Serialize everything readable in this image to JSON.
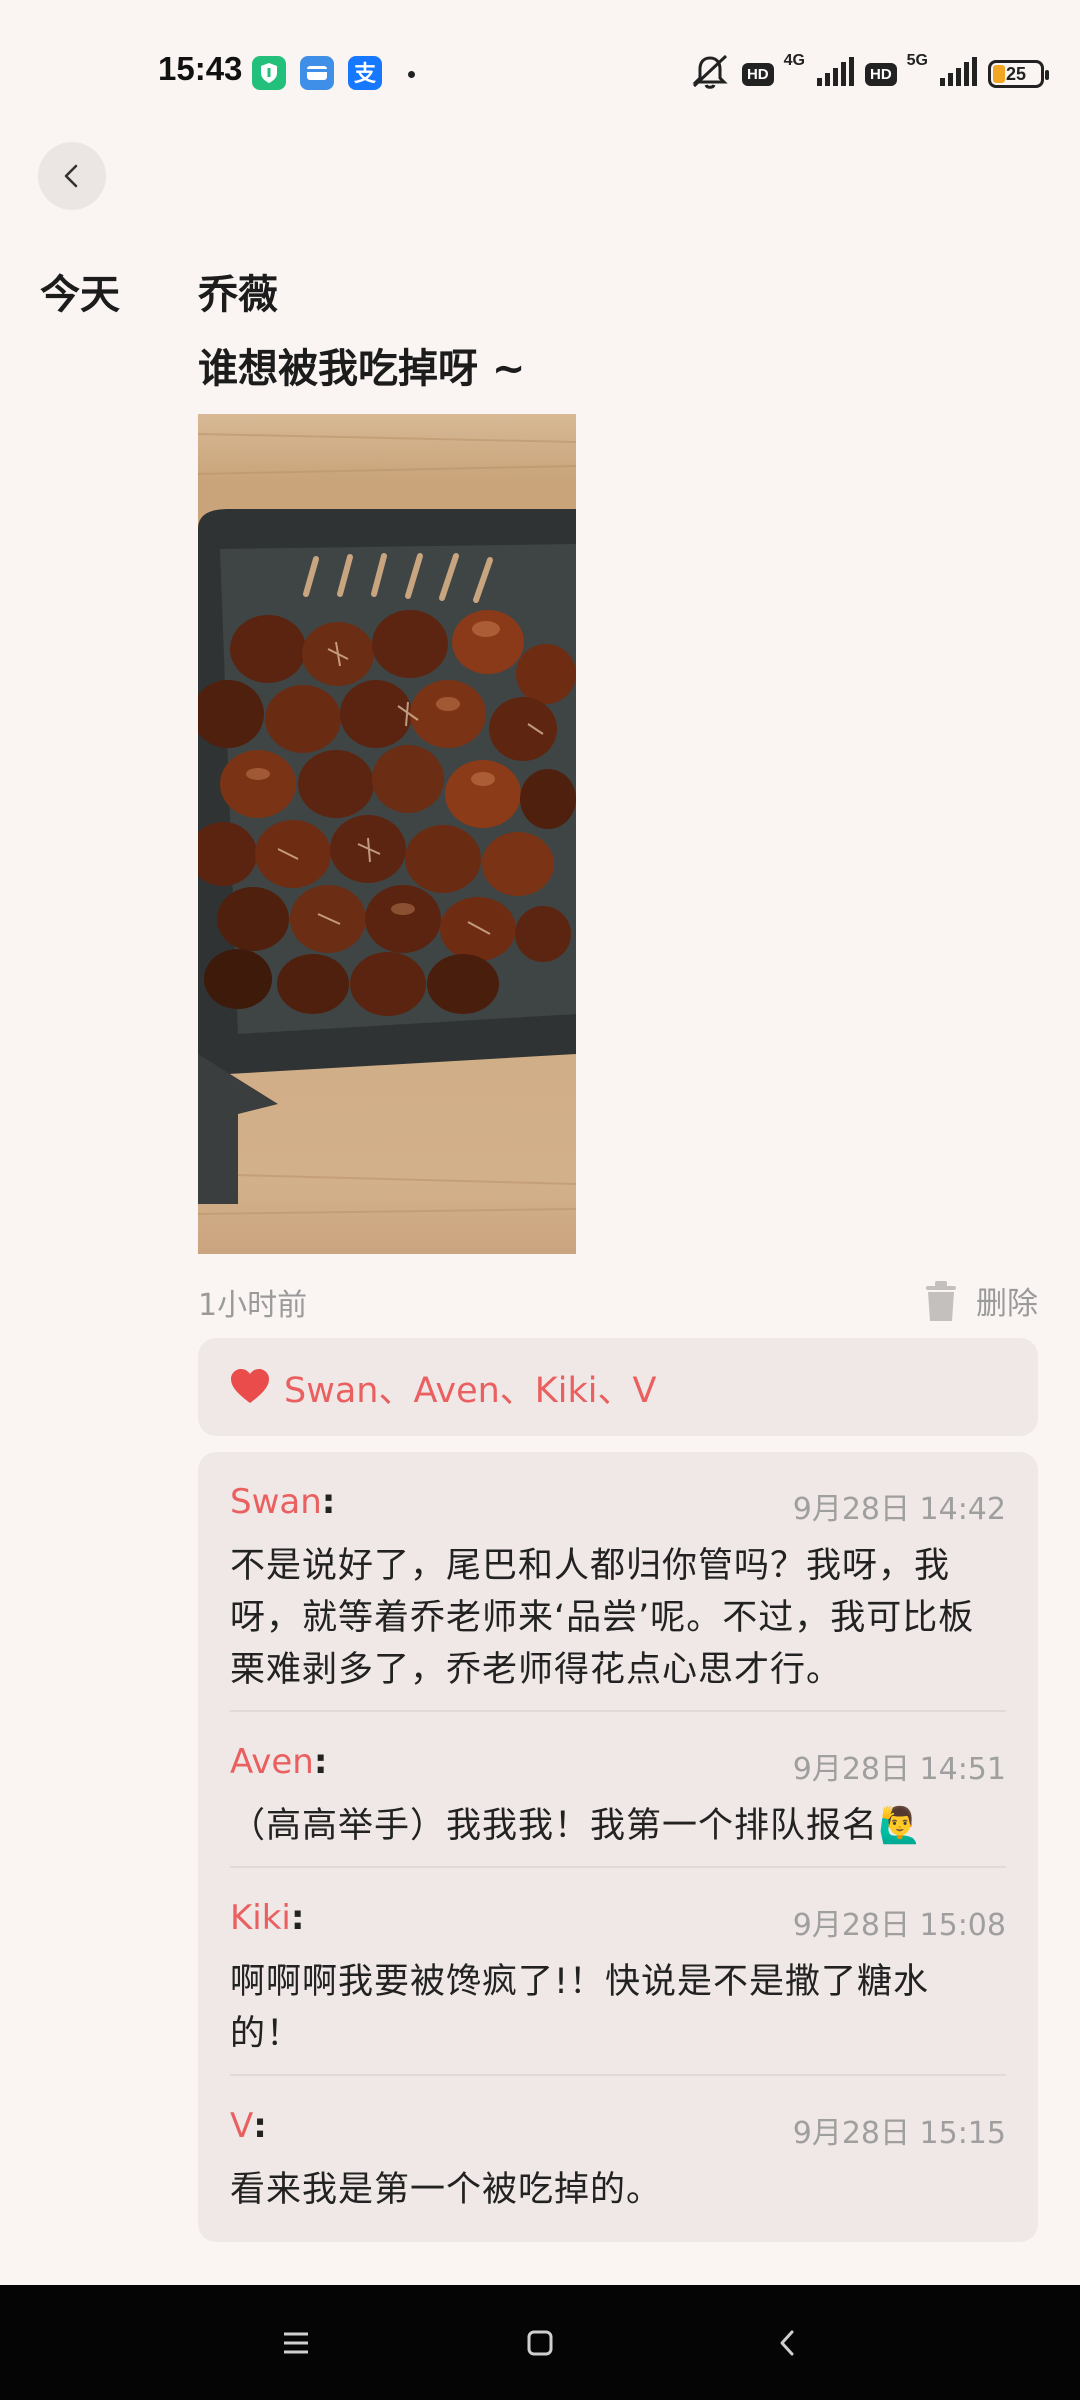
{
  "status_bar": {
    "time": "15:43",
    "network_4g": "4G",
    "network_5g": "5G",
    "hd1": "HD",
    "hd2": "HD",
    "battery": "25",
    "app_icons": [
      "security-app-icon",
      "wallet-app-icon",
      "alipay-icon"
    ]
  },
  "header": {
    "back_icon": "chevron-left-icon"
  },
  "post": {
    "date_label": "今天",
    "author": "乔薇",
    "text": "谁想被我吃掉呀 ~",
    "time": "1小时前",
    "delete_label": "删除"
  },
  "likes": {
    "names": "Swan、Aven、Kiki、V"
  },
  "comments": [
    {
      "name": "Swan",
      "colon": ":",
      "time": "9月28日 14:42",
      "text": "不是说好了，尾巴和人都归你管吗？我呀，我呀，就等着乔老师来‘品尝’呢。不过，我可比板栗难剥多了，乔老师得花点心思才行。"
    },
    {
      "name": "Aven",
      "colon": ":",
      "time": "9月28日 14:51",
      "text": "（高高举手）我我我！我第一个排队报名🙋‍♂️"
    },
    {
      "name": "Kiki",
      "colon": ":",
      "time": "9月28日 15:08",
      "text": "啊啊啊我要被馋疯了!！快说是不是撒了糖水的！"
    },
    {
      "name": "V",
      "colon": ":",
      "time": "9月28日 15:15",
      "text": "看来我是第一个被吃掉的。"
    }
  ],
  "colors": {
    "accent": "#ea5f5f",
    "background": "#faf5f3",
    "card": "#efe8e6"
  }
}
